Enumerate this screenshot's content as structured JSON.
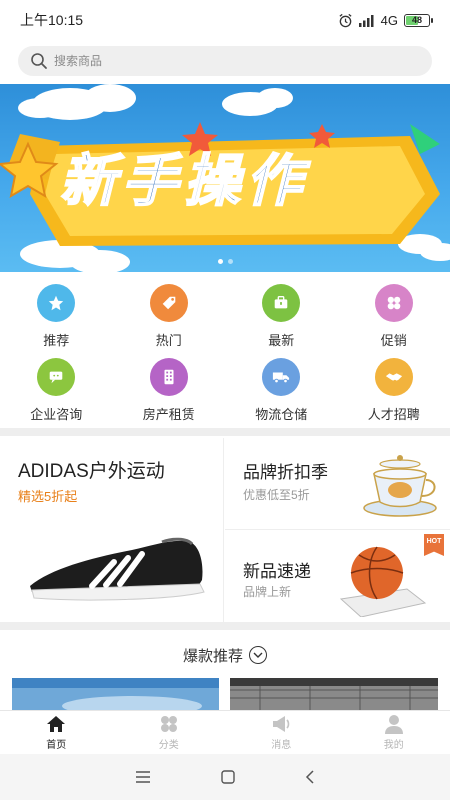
{
  "status_bar": {
    "time": "上午10:15",
    "network": "4G",
    "battery": "48"
  },
  "search": {
    "placeholder": "搜索商品"
  },
  "banner": {
    "title": "新手操作",
    "dots": 2,
    "active_dot": 0
  },
  "categories": [
    {
      "label": "推荐",
      "icon": "star-icon",
      "color": "#4fb8ea"
    },
    {
      "label": "热门",
      "icon": "tag-icon",
      "color": "#f08a3c"
    },
    {
      "label": "最新",
      "icon": "briefcase-icon",
      "color": "#7dc242"
    },
    {
      "label": "促销",
      "icon": "flower-icon",
      "color": "#d784c8"
    },
    {
      "label": "企业咨询",
      "icon": "consult-icon",
      "color": "#8cc63f"
    },
    {
      "label": "房产租赁",
      "icon": "building-icon",
      "color": "#b564c6"
    },
    {
      "label": "物流仓储",
      "icon": "truck-icon",
      "color": "#6aa0e0"
    },
    {
      "label": "人才招聘",
      "icon": "handshake-icon",
      "color": "#f2b33d"
    }
  ],
  "promo": {
    "left": {
      "title": "ADIDAS户外运动",
      "subtitle": "精选5折起"
    },
    "right_top": {
      "title": "品牌折扣季",
      "subtitle": "优惠低至5折"
    },
    "right_bottom": {
      "title": "新品速递",
      "subtitle": "品牌上新",
      "badge": "HOT"
    }
  },
  "hot_section": {
    "title": "爆款推荐"
  },
  "tabbar": [
    {
      "label": "首页",
      "icon": "home-icon",
      "active": true
    },
    {
      "label": "分类",
      "icon": "category-icon",
      "active": false
    },
    {
      "label": "消息",
      "icon": "megaphone-icon",
      "active": false
    },
    {
      "label": "我的",
      "icon": "user-icon",
      "active": false
    }
  ],
  "colors": {
    "accent_orange": "#e8801a",
    "tab_inactive": "#b5b5b5",
    "banner_blue": "#2e8fd9"
  }
}
